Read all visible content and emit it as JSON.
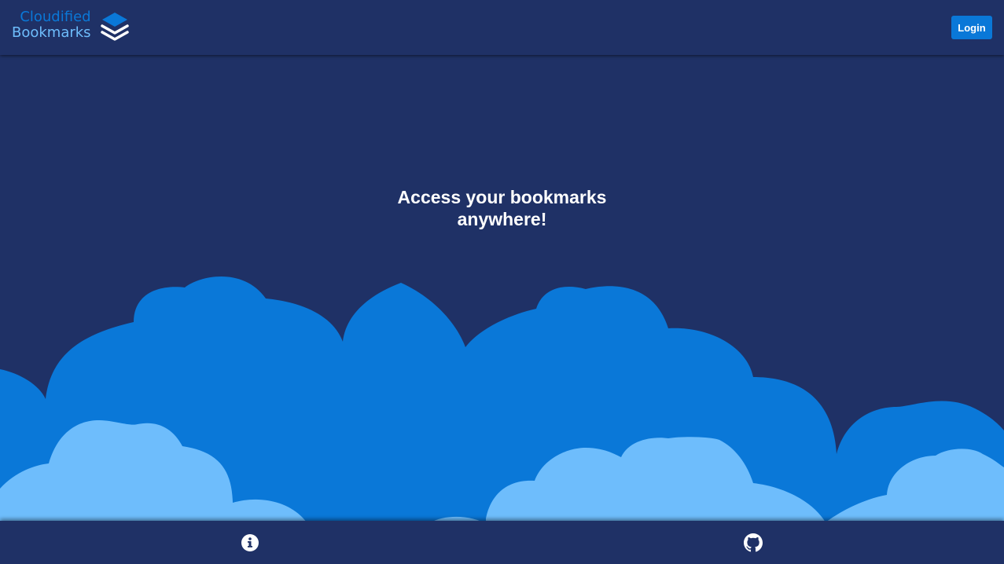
{
  "header": {
    "logo": {
      "line1": "Cloudified",
      "line2": "Bookmarks",
      "icon": "layers-icon"
    },
    "login_label": "Login"
  },
  "hero": {
    "title": "Access your bookmarks anywhere!"
  },
  "footer": {
    "icons": [
      "info-circle-icon",
      "github-icon"
    ]
  },
  "colors": {
    "background": "#1f3166",
    "cloud_back": "#0a78d8",
    "cloud_front": "#6ebdfc",
    "accent": "#0a78d8"
  }
}
